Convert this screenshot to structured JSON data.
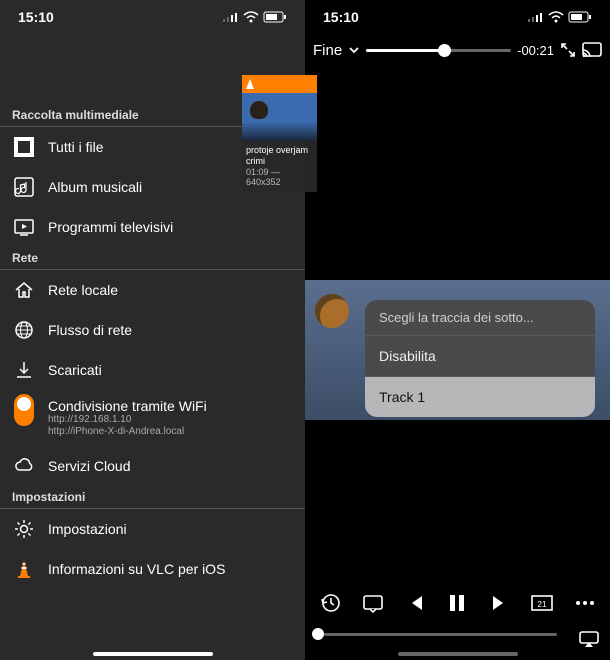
{
  "status": {
    "time": "15:10"
  },
  "video_card": {
    "title": "protoje overjam crimi",
    "meta": "01:09 — 640x352"
  },
  "menu": {
    "sections": {
      "media": {
        "header": "Raccolta multimediale",
        "all_files": "Tutti i file",
        "music_albums": "Album musicali",
        "tv_shows": "Programmi televisivi"
      },
      "network": {
        "header": "Rete",
        "local_network": "Rete locale",
        "network_stream": "Flusso di rete",
        "downloads": "Scaricati",
        "wifi_sharing": "Condivisione tramite WiFi",
        "wifi_url1": "http://192.168.1.10",
        "wifi_url2": "http://iPhone-X-di-Andrea.local",
        "cloud": "Servizi Cloud"
      },
      "settings": {
        "header": "Impostazioni",
        "settings": "Impostazioni",
        "about": "Informazioni su VLC per iOS"
      }
    }
  },
  "player": {
    "done_label": "Fine",
    "time_remaining": "-00:21",
    "scrub_progress_pct": 54
  },
  "subtitle_popup": {
    "title": "Scegli la traccia dei sotto...",
    "disable": "Disabilita",
    "track1": "Track 1"
  }
}
